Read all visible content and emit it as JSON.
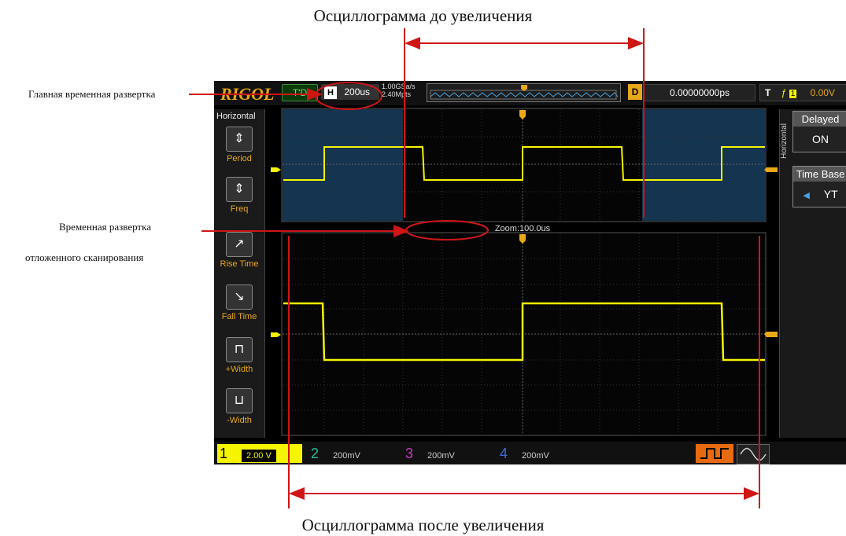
{
  "captions": {
    "top": "Осциллограмма до увеличения",
    "bottom": "Осциллограмма после увеличения",
    "main_timebase": "Главная временная развертка",
    "delayed_line1": "Временная развертка",
    "delayed_line2": "отложенного сканирования"
  },
  "scope": {
    "logo": "RIGOL",
    "mode": "T'D",
    "h_label": "H",
    "h_value": "200us",
    "sample_rate": "1.00GSa/s",
    "mem_depth": "2.40Mpts",
    "d_label": "D",
    "delay_value": "0.00000000ps",
    "trigger_label": "T",
    "trigger_level": "0.00V",
    "zoom_label": "Zoom:100.0us",
    "left_menu": {
      "title": "Horizontal",
      "items": [
        "Period",
        "Freq",
        "Rise Time",
        "Fall Time",
        "+Width",
        "-Width"
      ]
    },
    "right_menu": {
      "title": "Horizontal",
      "delayed_label": "Delayed",
      "delayed_value": "ON",
      "timebase_label": "Time Base",
      "timebase_value": "YT"
    },
    "channels": [
      {
        "num": "1",
        "value": "2.00 V",
        "color": "#f5f500"
      },
      {
        "num": "2",
        "value": "200mV",
        "color": "#2bb9a0"
      },
      {
        "num": "3",
        "value": "200mV",
        "color": "#c43bc4"
      },
      {
        "num": "4",
        "value": "200mV",
        "color": "#3a6fd8"
      }
    ],
    "markers": {
      "ch1": "1",
      "trig": "T"
    }
  },
  "colors": {
    "accent": "#e8a818",
    "signal": "#f5f500",
    "annotation": "#d01515",
    "zoom_window": "#153450"
  }
}
